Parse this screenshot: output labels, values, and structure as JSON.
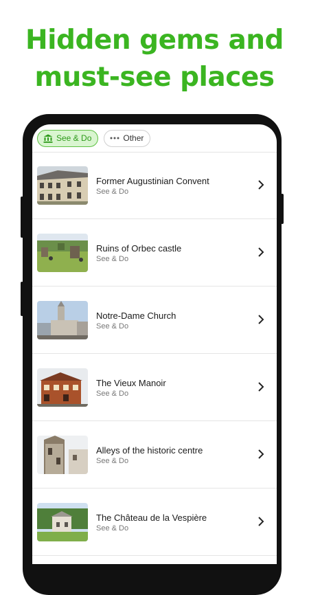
{
  "headline": {
    "line1": "Hidden gems and",
    "line2": "must-see places"
  },
  "filters": [
    {
      "label": "See & Do",
      "icon": "museum-icon",
      "active": true
    },
    {
      "label": "Other",
      "icon": "more-dots-icon",
      "active": false
    }
  ],
  "places": [
    {
      "title": "Former Augustinian Convent",
      "category": "See & Do"
    },
    {
      "title": "Ruins of Orbec castle",
      "category": "See & Do"
    },
    {
      "title": "Notre-Dame Church",
      "category": "See & Do"
    },
    {
      "title": "The Vieux Manoir",
      "category": "See & Do"
    },
    {
      "title": "Alleys of the historic centre",
      "category": "See & Do"
    },
    {
      "title": "The Château de la Vespière",
      "category": "See & Do"
    }
  ],
  "colors": {
    "accent": "#3bb521",
    "chip_active_bg": "#d9f5d0",
    "chip_active_border": "#5cc041"
  }
}
